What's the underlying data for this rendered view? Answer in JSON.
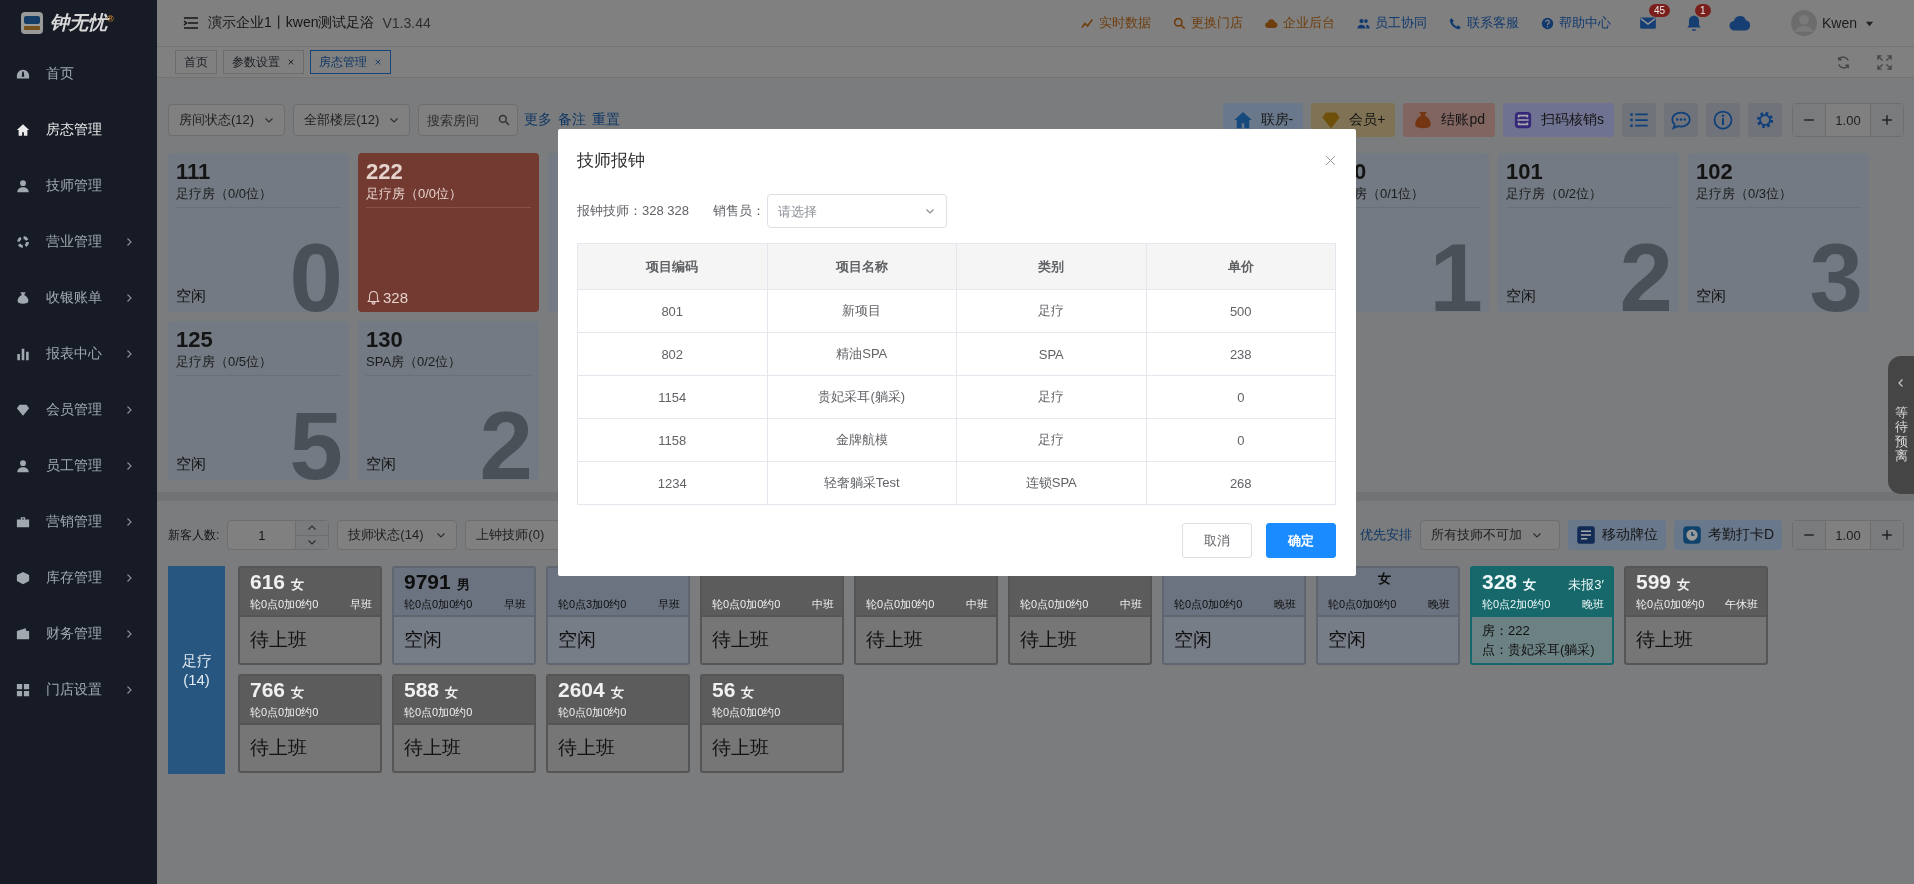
{
  "sidebar": {
    "logo": "钟无忧$^{®}$",
    "items": [
      {
        "label": "首页",
        "expandable": false,
        "selected": false
      },
      {
        "label": "房态管理",
        "expandable": false,
        "selected": true
      },
      {
        "label": "技师管理",
        "expandable": false,
        "selected": false
      },
      {
        "label": "营业管理",
        "expandable": true,
        "selected": false
      },
      {
        "label": "收银账单",
        "expandable": true,
        "selected": false
      },
      {
        "label": "报表中心",
        "expandable": true,
        "selected": false
      },
      {
        "label": "会员管理",
        "expandable": true,
        "selected": false
      },
      {
        "label": "员工管理",
        "expandable": true,
        "selected": false
      },
      {
        "label": "营销管理",
        "expandable": true,
        "selected": false
      },
      {
        "label": "库存管理",
        "expandable": true,
        "selected": false
      },
      {
        "label": "财务管理",
        "expandable": true,
        "selected": false
      },
      {
        "label": "门店设置",
        "expandable": true,
        "selected": false
      }
    ]
  },
  "header": {
    "title": "演示企业1丨kwen测试足浴",
    "version": "V1.3.44",
    "links": [
      {
        "label": "实时数据",
        "color": "#6e3d0c"
      },
      {
        "label": "更换门店",
        "color": "#6e3d0c"
      },
      {
        "label": "企业后台",
        "color": "#6e3d0c"
      },
      {
        "label": "员工协同",
        "color": "#123a6e"
      },
      {
        "label": "联系客服",
        "color": "#123a6e"
      },
      {
        "label": "帮助中心",
        "color": "#123a6e"
      }
    ],
    "mail_badge": "45",
    "bell_badge": "1",
    "user": "Kwen"
  },
  "tabs": [
    {
      "label": "首页",
      "closable": false,
      "selected": false
    },
    {
      "label": "参数设置",
      "closable": true,
      "selected": false
    },
    {
      "label": "房态管理",
      "closable": true,
      "selected": true
    }
  ],
  "room_toolbar": {
    "filters": [
      "房间状态(12)",
      "全部楼层(12)"
    ],
    "search": {
      "placeholder": "搜索房间"
    },
    "links": [
      "更多",
      "备注",
      "重置"
    ],
    "actions": [
      {
        "label": "联房-",
        "color": "#6a788c"
      },
      {
        "label": "会员+",
        "color": "#807255"
      },
      {
        "label": "结账pd",
        "color": "#806560"
      },
      {
        "label": "扫码核销s",
        "color": "#6f7290"
      }
    ],
    "zoom": "1.00"
  },
  "rooms": [
    {
      "kind": "free",
      "number": "111",
      "type": "足疗房（0/0位）",
      "status": "空闲",
      "seat_digit": "0"
    },
    {
      "kind": "in-use",
      "number": "222",
      "type": "足疗房（0/0位）",
      "alert": "328"
    },
    {
      "kind": "clipped",
      "number": "0",
      "type": "房（0/1位）",
      "seat_digit": "1"
    },
    {
      "kind": "free",
      "number": "101",
      "type": "足疗房（0/2位）",
      "status": "空闲",
      "seat_digit": "2"
    },
    {
      "kind": "free",
      "number": "102",
      "type": "足疗房（0/3位）",
      "status": "空闲",
      "seat_digit": "3"
    },
    {
      "kind": "free",
      "number": "125",
      "type": "足疗房（0/5位）",
      "status": "空闲",
      "seat_digit": "5"
    },
    {
      "kind": "free",
      "number": "130",
      "type": "SPA房（0/2位）",
      "status": "空闲",
      "seat_digit": "2"
    }
  ],
  "tech_toolbar": {
    "guest_label": "新客人数:",
    "guest_count": "1",
    "filters": [
      "技师状态(14)",
      "上钟技师(0)"
    ],
    "priority_link": "优先安排",
    "overtime_select": "所有技师不可加",
    "actions": [
      "移动牌位",
      "考勤打卡D"
    ],
    "zoom": "1.00"
  },
  "tech_group": {
    "name": "足疗",
    "count": "(14)"
  },
  "techs": [
    {
      "kind": "off",
      "number": "616",
      "gender": "女",
      "tally": "轮0点0加0约0",
      "shift": "早班",
      "status": "待上班"
    },
    {
      "kind": "idle",
      "number": "9791",
      "gender": "男",
      "tally": "轮0点0加0约0",
      "shift": "早班",
      "status": "空闲"
    },
    {
      "kind": "idle",
      "tally": "轮0点3加0约0",
      "shift": "早班",
      "status": "空闲"
    },
    {
      "kind": "off",
      "tally": "轮0点0加0约0",
      "shift": "中班",
      "status": "待上班"
    },
    {
      "kind": "off",
      "tally": "轮0点0加0约0",
      "shift": "中班",
      "status": "待上班"
    },
    {
      "kind": "off",
      "tally": "轮0点0加0约0",
      "shift": "中班",
      "status": "待上班"
    },
    {
      "kind": "idle",
      "tally": "轮0点0加0约0",
      "shift": "晚班",
      "status": "空闲"
    },
    {
      "kind": "idle",
      "gender": "女",
      "tally": "轮0点0加0约0",
      "shift": "晚班",
      "status": "空闲"
    },
    {
      "kind": "busy",
      "number": "328",
      "gender": "女",
      "note": "未报3′",
      "tally": "轮0点2加0约0",
      "shift": "晚班",
      "room": "房：222",
      "item": "点：贵妃采耳(躺采)"
    },
    {
      "kind": "off",
      "number": "599",
      "gender": "女",
      "tally": "轮0点0加0约0",
      "shift": "午休班",
      "status": "待上班"
    },
    {
      "kind": "off",
      "number": "766",
      "gender": "女",
      "tally": "轮0点0加0约0",
      "status": "待上班"
    },
    {
      "kind": "off",
      "number": "588",
      "gender": "女",
      "tally": "轮0点0加0约0",
      "status": "待上班"
    },
    {
      "kind": "off",
      "number": "2604",
      "gender": "女",
      "tally": "轮0点0加0约0",
      "status": "待上班"
    },
    {
      "kind": "off",
      "number": "56",
      "gender": "女",
      "tally": "轮0点0加0约0",
      "status": "待上班"
    }
  ],
  "drawer_tab": {
    "label": "等待预离"
  },
  "dialog": {
    "title": "技师报钟",
    "tech_label": "报钟技师：328 328",
    "seller_label": "销售员：",
    "seller_select": {
      "placeholder": "请选择"
    },
    "table": {
      "columns": [
        "项目编码",
        "项目名称",
        "类别",
        "单价"
      ],
      "rows": [
        [
          "801",
          "新项目",
          "足疗",
          "500"
        ],
        [
          "802",
          "精油SPA",
          "SPA",
          "238"
        ],
        [
          "1154",
          "贵妃采耳(躺采)",
          "足疗",
          "0"
        ],
        [
          "1158",
          "金牌航模",
          "足疗",
          "0"
        ],
        [
          "1234",
          "轻奢躺采Test",
          "连锁SPA",
          "268"
        ]
      ]
    },
    "buttons": [
      {
        "label": "取消",
        "kind": "secondary"
      },
      {
        "label": "确定",
        "kind": "primary"
      }
    ]
  }
}
